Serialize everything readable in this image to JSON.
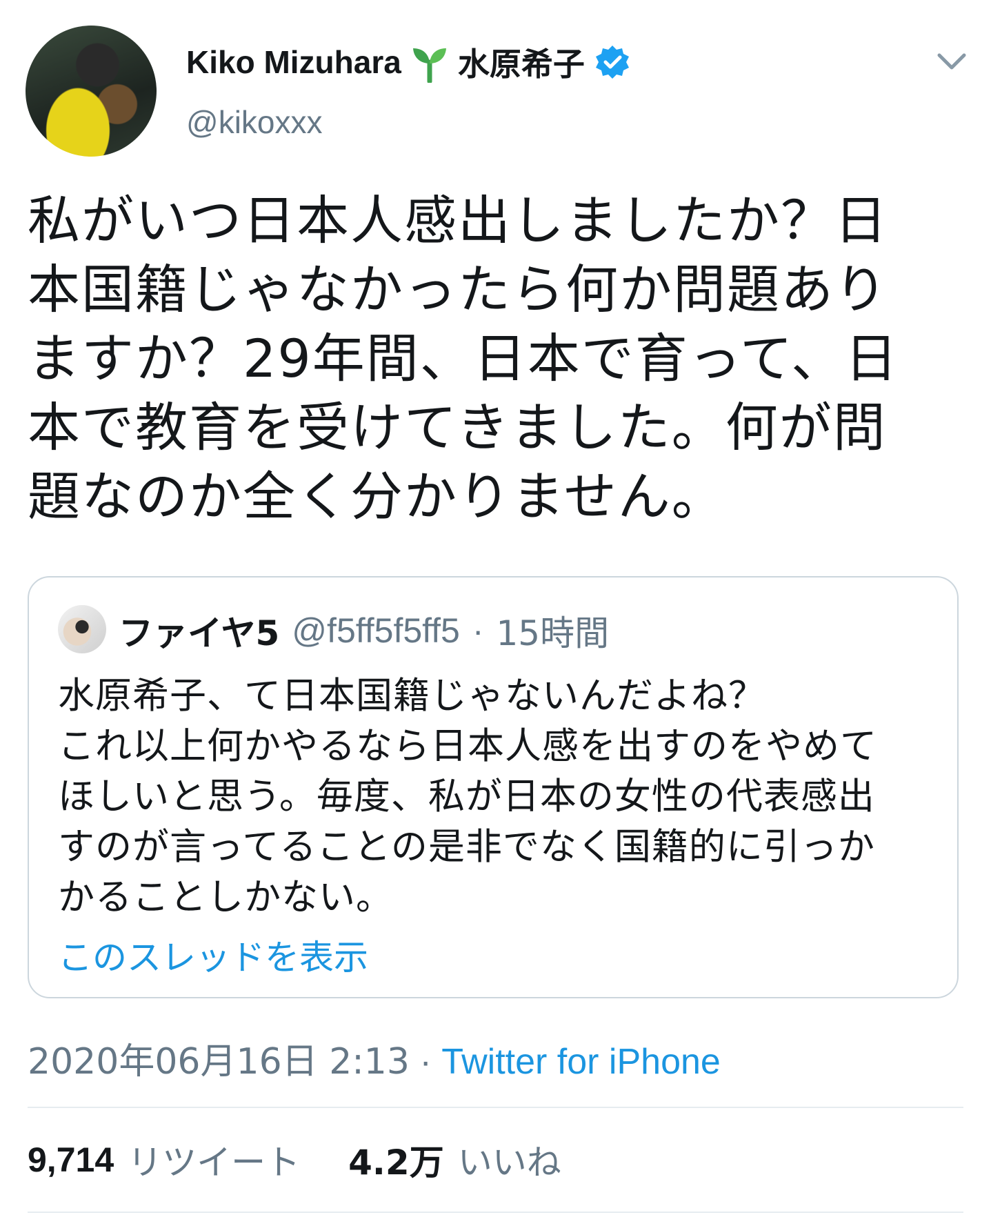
{
  "author": {
    "display_name_latin": "Kiko Mizuhara",
    "display_name_jp": "水原希子",
    "handle": "@kikoxxx",
    "emoji_icon": "seedling-icon",
    "verified_icon": "verified-badge-icon"
  },
  "tweet": {
    "text": "私がいつ日本人感出しましたか？日\n本国籍じゃなかったら何か問題あり\nますか？29年間、日本で育って、日\n本で教育を受けてきました。何が問\n題なのか全く分かりません。"
  },
  "quoted": {
    "name": "ファイヤ5",
    "handle": "@f5ff5f5ff5",
    "separator": "·",
    "time": "15時間",
    "text": "水原希子、て日本国籍じゃないんだよね？\nこれ以上何かやるなら日本人感を出すのをやめて\nほしいと思う。毎度、私が日本の女性の代表感出\nすのが言ってることの是非でなく国籍的に引っか\nかることしかない。",
    "thread_link": "このスレッドを表示"
  },
  "meta": {
    "timestamp": "2020年06月16日 2:13",
    "separator": "·",
    "source": "Twitter for iPhone"
  },
  "stats": {
    "retweets_count": "9,714",
    "retweets_label": "リツイート",
    "likes_count": "4.2万",
    "likes_label": "いいね"
  },
  "colors": {
    "text": "#14171a",
    "secondary": "#657786",
    "link": "#1b95e0",
    "border": "#ccd6dd",
    "verified": "#1da1f2",
    "sprout": "#3fa34d"
  }
}
